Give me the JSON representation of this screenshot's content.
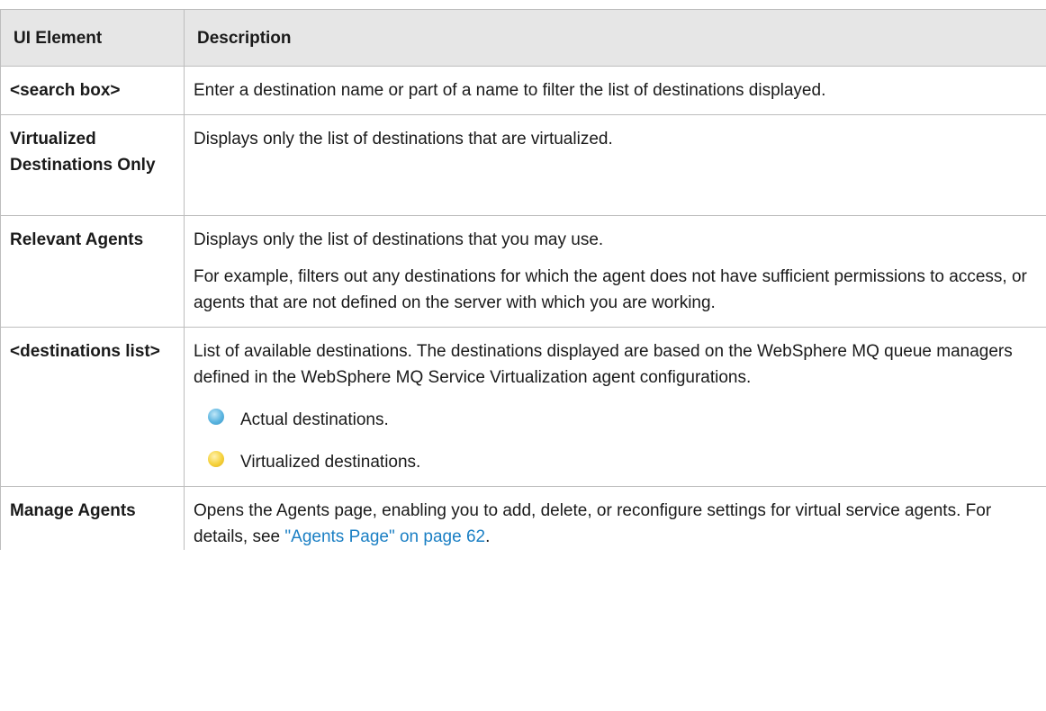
{
  "table": {
    "headers": [
      "UI Element",
      "Description"
    ],
    "rows": [
      {
        "name": "<search box>",
        "description": [
          "Enter a destination name or part of a name to filter the list of destinations displayed."
        ]
      },
      {
        "name": "Virtualized Destinations Only",
        "description": [
          "Displays only the list of destinations that are virtualized."
        ]
      },
      {
        "name": "Relevant Agents",
        "description": [
          "Displays only the list of destinations that you may use.",
          "For example, filters out any destinations for which the agent does not have sufficient permissions to access, or agents that are not defined on the server with which you are working."
        ]
      },
      {
        "name": "<destinations list>",
        "description": [
          "List of available destinations. The destinations displayed are based on the WebSphere MQ queue managers defined in the WebSphere MQ Service Virtualization agent configurations."
        ],
        "legend": [
          {
            "icon": "blue-circle-icon",
            "color": "#5ab4e0",
            "label": "Actual destinations."
          },
          {
            "icon": "yellow-circle-icon",
            "color": "#f5d13a",
            "label": "Virtualized destinations."
          }
        ]
      },
      {
        "name": "Manage Agents",
        "description_before": "Opens the Agents page, enabling you to add, delete, or reconfigure settings for virtual service agents. For details, see ",
        "link_text": "\"Agents Page\" on page 62",
        "description_after": "."
      }
    ]
  }
}
